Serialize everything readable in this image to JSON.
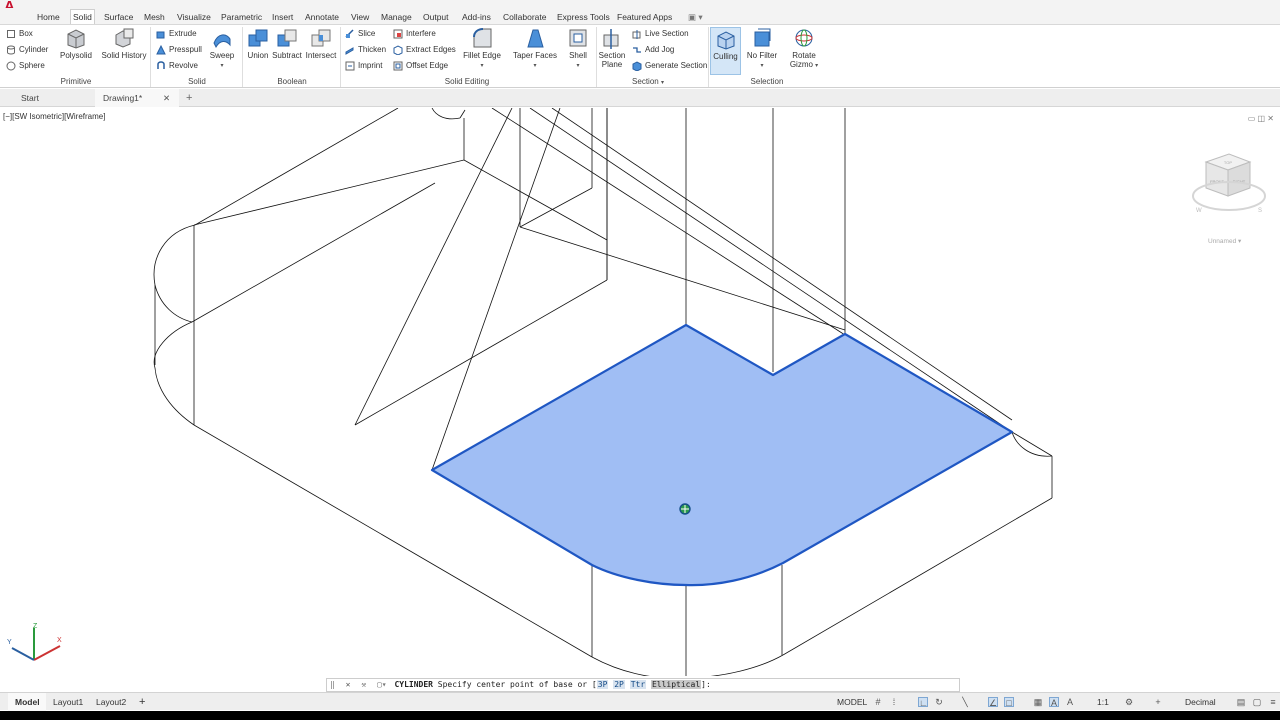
{
  "app": {
    "logo": "A"
  },
  "ribbon_tabs": [
    "Home",
    "Solid",
    "Surface",
    "Mesh",
    "Visualize",
    "Parametric",
    "Insert",
    "Annotate",
    "View",
    "Manage",
    "Output",
    "Add-ins",
    "Collaborate",
    "Express Tools",
    "Featured Apps"
  ],
  "ribbon_tab_overflow": "▣ ▾",
  "active_ribbon_tab": "Solid",
  "panels": {
    "primitive": {
      "title": "Primitive",
      "box": "Box",
      "cylinder": "Cylinder",
      "sphere": "Sphere",
      "polysolid": "Polysolid",
      "solid_history": "Solid History"
    },
    "solid": {
      "title": "Solid",
      "extrude": "Extrude",
      "presspull": "Presspull",
      "revolve": "Revolve",
      "sweep": "Sweep"
    },
    "boolean": {
      "title": "Boolean",
      "union": "Union",
      "subtract": "Subtract",
      "intersect": "Intersect"
    },
    "solid_editing": {
      "title": "Solid Editing",
      "slice": "Slice",
      "thicken": "Thicken",
      "imprint": "Imprint",
      "interfere": "Interfere",
      "extract_edges": "Extract Edges",
      "offset_edge": "Offset Edge",
      "fillet_edge": "Fillet Edge",
      "taper_faces": "Taper Faces",
      "shell": "Shell"
    },
    "section": {
      "title": "Section",
      "section_plane_1": "Section",
      "section_plane_2": "Plane",
      "live_section": "Live Section",
      "add_jog": "Add Jog",
      "generate_section": "Generate Section"
    },
    "selection": {
      "title": "Selection",
      "culling": "Culling",
      "no_filter": "No Filter",
      "rotate_gizmo_1": "Rotate",
      "rotate_gizmo_2": "Gizmo"
    }
  },
  "file_tabs": {
    "start": "Start",
    "drawing": "Drawing1*",
    "close": "✕",
    "add": "+"
  },
  "viewport": {
    "label": "[−][SW Isometric][Wireframe]",
    "controls": "▭ ◫ ✕",
    "wcs": "Unnamed ▾",
    "cube_faces": {
      "front": "FRONT",
      "right": "RIGHT",
      "top": "TOP"
    },
    "compass": {
      "w": "W",
      "s": "S"
    },
    "ucs": {
      "x": "X",
      "y": "Y",
      "z": "Z"
    },
    "highlight_color": "#8fb3f2",
    "highlight_stroke": "#1f57c3"
  },
  "command_line": {
    "command": "CYLINDER",
    "prompt": "Specify center point of base or [",
    "options": [
      "3P",
      "2P",
      "Ttr",
      "Elliptical"
    ],
    "suffix": "]:"
  },
  "status_bar": {
    "tabs": [
      "Model",
      "Layout1",
      "Layout2"
    ],
    "add": "+",
    "model_label": "MODEL",
    "scale": "1:1",
    "units": "Decimal"
  }
}
